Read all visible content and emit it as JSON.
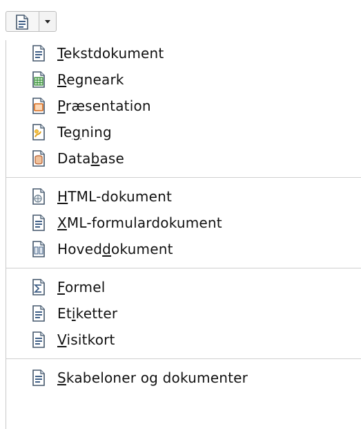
{
  "toolbar": {
    "new_button_icon": "text-document-icon",
    "dropdown_icon": "chevron-down-icon"
  },
  "menu": {
    "groups": [
      [
        {
          "label": "Tekstdokument",
          "ul": 0,
          "icon": "text-document-icon",
          "accent": "#3f5f86"
        },
        {
          "label": "Regneark",
          "ul": 0,
          "icon": "spreadsheet-icon",
          "accent": "#2c8a2c"
        },
        {
          "label": "Præsentation",
          "ul": 0,
          "icon": "presentation-icon",
          "accent": "#d6681a"
        },
        {
          "label": "Tegning",
          "ul": 2,
          "icon": "drawing-icon",
          "accent": "#e0a21a"
        },
        {
          "label": "Database",
          "ul": 4,
          "icon": "database-icon",
          "accent": "#b45b2c"
        }
      ],
      [
        {
          "label": "HTML-dokument",
          "ul": 0,
          "icon": "html-document-icon",
          "accent": "#6b7f8f"
        },
        {
          "label": "XML-formulardokument",
          "ul": 0,
          "icon": "xml-form-document-icon",
          "accent": "#3f5f86"
        },
        {
          "label": "Hoveddokument",
          "ul": 5,
          "icon": "master-document-icon",
          "accent": "#3f5f86"
        }
      ],
      [
        {
          "label": "Formel",
          "ul": 0,
          "icon": "formula-icon",
          "accent": "#3f5f86"
        },
        {
          "label": "Etiketter",
          "ul": 2,
          "icon": "labels-icon",
          "accent": "#3f5f86"
        },
        {
          "label": "Visitkort",
          "ul": 0,
          "icon": "business-cards-icon",
          "accent": "#3f5f86"
        }
      ],
      [
        {
          "label": "Skabeloner og dokumenter",
          "ul": 0,
          "icon": "templates-and-documents-icon",
          "accent": "#3f5f86"
        }
      ]
    ]
  }
}
